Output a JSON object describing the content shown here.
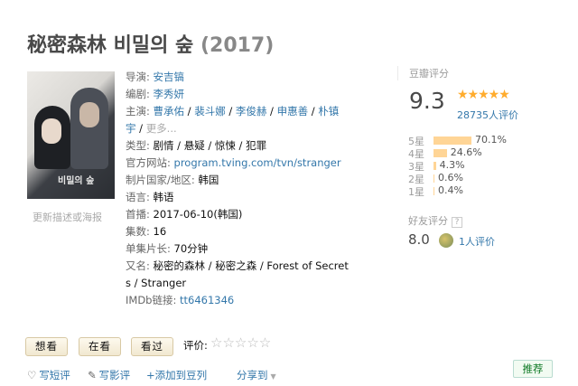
{
  "title": {
    "name": "秘密森林 비밀의 숲",
    "year": "(2017)"
  },
  "poster": {
    "caption": "비밀의 숲"
  },
  "update_link": "更新描述或海报",
  "info": {
    "director_label": "导演:",
    "director": "安吉镐",
    "writer_label": "编剧:",
    "writer": "李秀妍",
    "cast_label": "主演:",
    "cast": [
      "曹承佑",
      "裴斗娜",
      "李俊赫",
      "申惠善",
      "朴镇"
    ],
    "cast_cont": "宇",
    "cast_more": "更多...",
    "genre_label": "类型:",
    "genre": "剧情 / 悬疑 / 惊悚 / 犯罪",
    "site_label": "官方网站:",
    "site": "program.tving.com/tvn/stranger",
    "country_label": "制片国家/地区:",
    "country": "韩国",
    "language_label": "语言:",
    "language": "韩语",
    "premiere_label": "首播:",
    "premiere": "2017-06-10(韩国)",
    "episodes_label": "集数:",
    "episodes": "16",
    "runtime_label": "单集片长:",
    "runtime": "70分钟",
    "aka_label": "又名:",
    "aka": "秘密的森林 / 秘密之森 / Forest of Secret",
    "aka_cont": "s / Stranger",
    "imdb_label": "IMDb链接:",
    "imdb": "tt6461346"
  },
  "rating": {
    "title": "豆瓣评分",
    "score": "9.3",
    "stars": "★★★★★",
    "count": "28735人评价",
    "distribution": [
      {
        "label": "5星",
        "pct": "70.1%",
        "value": 70.1
      },
      {
        "label": "4星",
        "pct": "24.6%",
        "value": 24.6
      },
      {
        "label": "3星",
        "pct": "4.3%",
        "value": 4.3
      },
      {
        "label": "2星",
        "pct": "0.6%",
        "value": 0.6
      },
      {
        "label": "1星",
        "pct": "0.4%",
        "value": 0.4
      }
    ],
    "bar_color": "#ffd596"
  },
  "friend": {
    "title": "好友评分",
    "help": "?",
    "score": "8.0",
    "count": "1人评价"
  },
  "buttons": {
    "want": "想看",
    "watching": "在看",
    "watched": "看过"
  },
  "rate": {
    "label": "评价:",
    "stars": "☆☆☆☆☆"
  },
  "actions": {
    "short_review": "写短评",
    "long_review": "写影评",
    "add_list": "+添加到豆列",
    "share": "分享到"
  },
  "recommend": "推荐",
  "colors": {
    "link": "#37a",
    "star": "#ffac2d",
    "recommend": "#0c7823"
  }
}
